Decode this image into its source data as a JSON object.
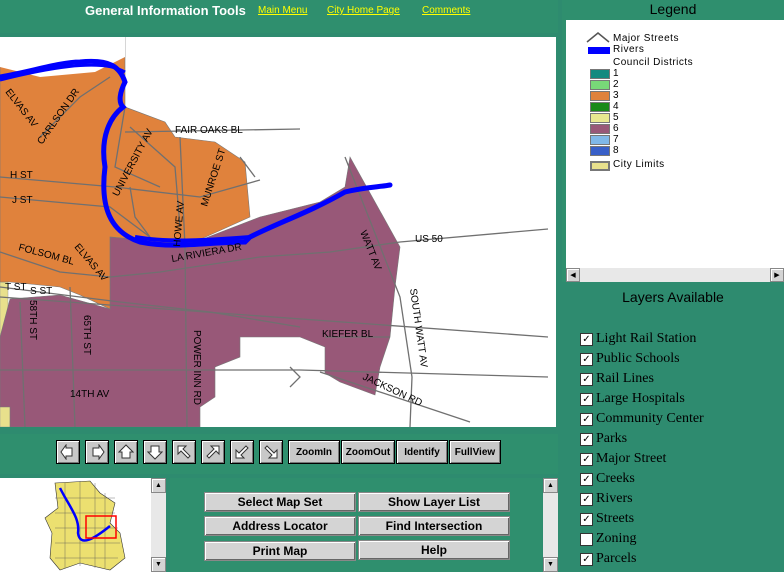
{
  "header": {
    "title": "General Information Tools",
    "links": [
      "Main Menu",
      "City Home Page",
      "Comments"
    ]
  },
  "map": {
    "labels": [
      "ELVAS AV",
      "CARLSON DR",
      "UNIVERSITY AV",
      "FAIR OAKS BL",
      "MUNROE ST",
      "H ST",
      "J ST",
      "HOWE AV",
      "LA RIVIERA DR",
      "WATT AV",
      "US 50",
      "FOLSOM BL",
      "ELVAS AV",
      "T ST",
      "S ST",
      "58TH ST",
      "65TH ST",
      "SOUTH WATT AV",
      "KIEFER BL",
      "POWER INN RD",
      "14TH AV",
      "JACKSON RD"
    ]
  },
  "toolbar": {
    "icon_buttons": [
      "pan-west",
      "pan-east",
      "pan-north",
      "pan-south",
      "pan-northwest",
      "pan-northeast",
      "pan-southwest",
      "pan-southeast"
    ],
    "text_buttons": [
      "ZoomIn",
      "ZoomOut",
      "Identify",
      "FullView"
    ]
  },
  "functions": {
    "buttons": [
      "Select Map Set",
      "Show Layer List",
      "Address Locator",
      "Find Intersection",
      "Print Map",
      "Help"
    ]
  },
  "legend": {
    "title": "Legend",
    "major_streets": "Major Streets",
    "rivers": "Rivers",
    "council_districts": "Council Districts",
    "districts": [
      {
        "label": "1",
        "color": "#138a80"
      },
      {
        "label": "2",
        "color": "#78d878"
      },
      {
        "label": "3",
        "color": "#e0823c"
      },
      {
        "label": "4",
        "color": "#188a18"
      },
      {
        "label": "5",
        "color": "#e8e890"
      },
      {
        "label": "6",
        "color": "#985878"
      },
      {
        "label": "7",
        "color": "#80b8e8"
      },
      {
        "label": "8",
        "color": "#3860c8"
      }
    ],
    "city_limits": "City Limits",
    "city_limits_color": "#e8e08c"
  },
  "layers": {
    "title": "Layers Available",
    "items": [
      {
        "name": "Light Rail Station",
        "checked": true
      },
      {
        "name": "Public Schools",
        "checked": true
      },
      {
        "name": "Rail Lines",
        "checked": true
      },
      {
        "name": "Large Hospitals",
        "checked": true
      },
      {
        "name": "Community Center",
        "checked": true
      },
      {
        "name": "Parks",
        "checked": true
      },
      {
        "name": "Major Street",
        "checked": true
      },
      {
        "name": "Creeks",
        "checked": true
      },
      {
        "name": "Rivers",
        "checked": true
      },
      {
        "name": "Streets",
        "checked": true
      },
      {
        "name": "Zoning",
        "checked": false
      },
      {
        "name": "Parcels",
        "checked": true
      }
    ]
  },
  "colors": {
    "panel_bg": "#2f8f6e",
    "link": "#ffff00",
    "river": "#0000ff",
    "district3": "#e0823c",
    "district6": "#985878"
  }
}
